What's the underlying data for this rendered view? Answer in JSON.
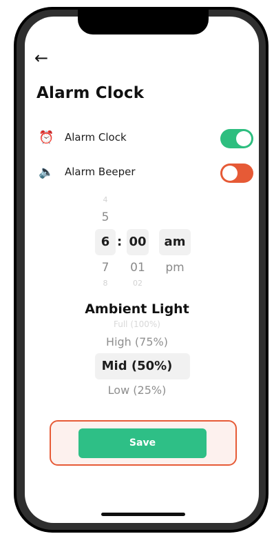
{
  "colors": {
    "toggle_on": "#2dbe7f",
    "toggle_off": "#e65a36",
    "save_button": "#2ebf86",
    "highlight_border": "#e65a36"
  },
  "nav": {
    "back_icon": "arrow-left-icon",
    "back_glyph": "←"
  },
  "header": {
    "title": "Alarm Clock"
  },
  "settings": [
    {
      "icon": "alarm-clock-icon",
      "icon_glyph": "⏰",
      "label": "Alarm Clock",
      "enabled": true
    },
    {
      "icon": "speaker-icon",
      "icon_glyph": "🔈",
      "label": "Alarm Beeper",
      "enabled": false
    }
  ],
  "time_picker": {
    "hour": {
      "above_faint": "4",
      "above": "5",
      "selected": "6",
      "below": "7",
      "below_faint": "8"
    },
    "separator": ":",
    "minute": {
      "selected": "00",
      "below": "01",
      "below_faint": "02"
    },
    "period": {
      "selected": "am",
      "below": "pm"
    }
  },
  "ambient_light": {
    "title": "Ambient Light",
    "options": {
      "above_faint": "Full (100%)",
      "above": "High (75%)",
      "selected": "Mid (50%)",
      "below": "Low (25%)"
    }
  },
  "save": {
    "label": "Save"
  }
}
